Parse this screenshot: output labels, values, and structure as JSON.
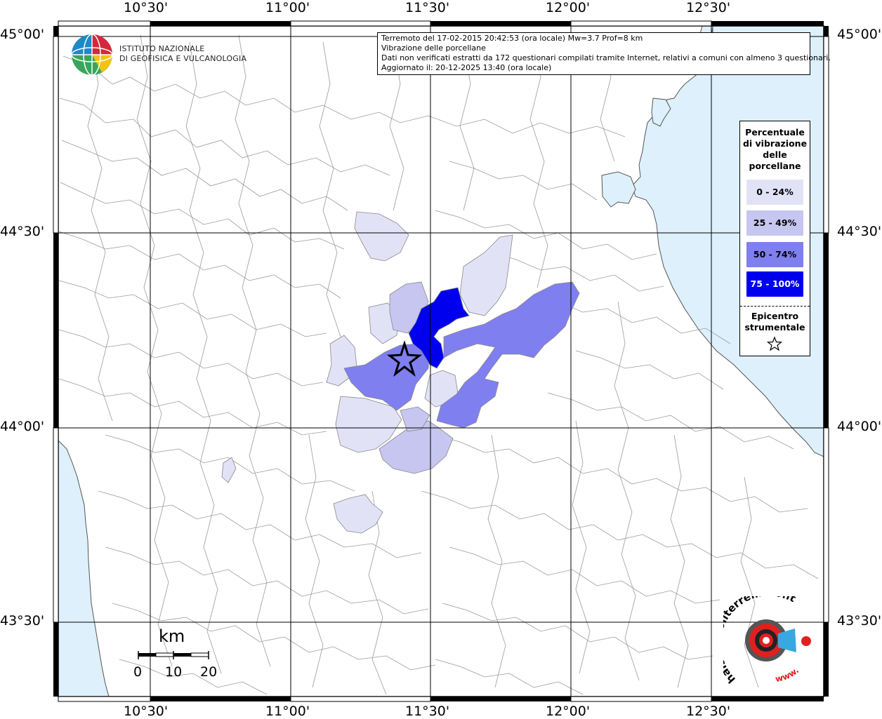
{
  "map": {
    "title_lines": [
      "Terremoto del 17-02-2015 20:42:53 (ora locale) Mw=3.7 Prof=8 km",
      "Vibrazione delle porcellane",
      "Dati non verificati estratti da 172 questionari compilati tramite Internet, relativi a comuni con almeno 3 questionari.",
      "Aggiornato il: 20-12-2025 13:40 (ora locale)"
    ],
    "longitude_labels": [
      "10°30'",
      "11°00'",
      "11°30'",
      "12°00'",
      "12°30'"
    ],
    "latitude_labels": [
      "45°00'",
      "44°30'",
      "44°00'",
      "43°30'"
    ],
    "colors": {
      "sea": "#ddf0fb",
      "class_0_24": "#e2e2f7",
      "class_25_49": "#c6c6f1",
      "class_50_74": "#7f7ff0",
      "class_75_100": "#0000ee",
      "grid": "#000000",
      "boundaries": "#9a9a9a"
    }
  },
  "logo": {
    "institute_line1": "ISTITUTO NAZIONALE",
    "institute_line2": "DI GEOFISICA E VULCANOLOGIA",
    "website_text": "haisentitoilterremoto.it",
    "website_prefix": "www."
  },
  "legend": {
    "title_lines": [
      "Percentuale",
      "di vibrazione",
      "delle",
      "porcellane"
    ],
    "classes": [
      {
        "label": "0 - 24%"
      },
      {
        "label": "25 - 49%"
      },
      {
        "label": "50 - 74%"
      },
      {
        "label": "75 - 100%"
      }
    ],
    "epicenter_lines": [
      "Epicentro",
      "strumentale"
    ],
    "epicenter_icon": "star-outline-icon"
  },
  "scale": {
    "unit": "km",
    "ticks": [
      "0",
      "10",
      "20"
    ]
  },
  "epicenter": {
    "lon": "11°24'",
    "lat": "44°10'"
  }
}
